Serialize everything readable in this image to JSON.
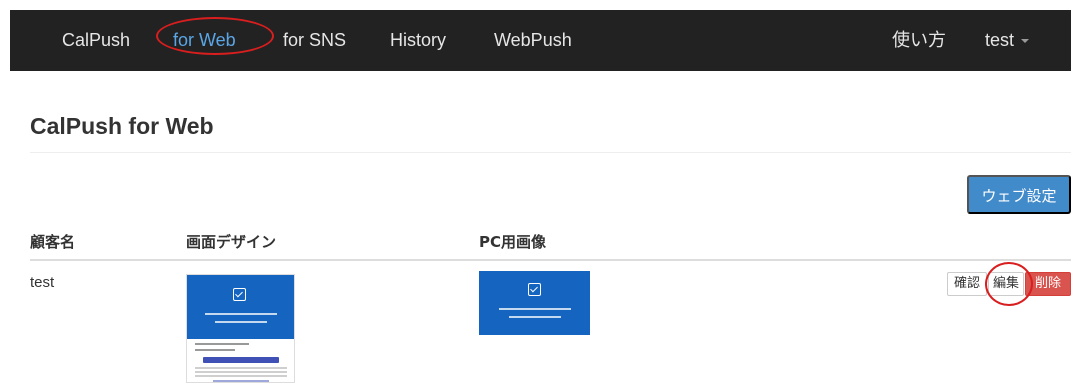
{
  "navbar": {
    "brand": "CalPush",
    "items": [
      {
        "label": "for Web",
        "active": true
      },
      {
        "label": "for SNS"
      },
      {
        "label": "History"
      },
      {
        "label": "WebPush"
      }
    ],
    "usage": "使い方",
    "user": "test"
  },
  "page": {
    "title": "CalPush for Web",
    "web_settings_button": "ウェブ設定"
  },
  "table": {
    "headers": [
      "顧客名",
      "画面デザイン",
      "PC用画像"
    ],
    "rows": [
      {
        "customer": "test",
        "actions": {
          "confirm": "確認",
          "edit": "編集",
          "delete": "削除"
        }
      }
    ]
  },
  "colors": {
    "navbar_bg": "#222222",
    "active_nav": "#5aa6e6",
    "primary_button": "#428bca",
    "danger_button": "#d9534f",
    "thumbnail_blue": "#1565c0",
    "highlight_circle": "#d81e1e"
  }
}
